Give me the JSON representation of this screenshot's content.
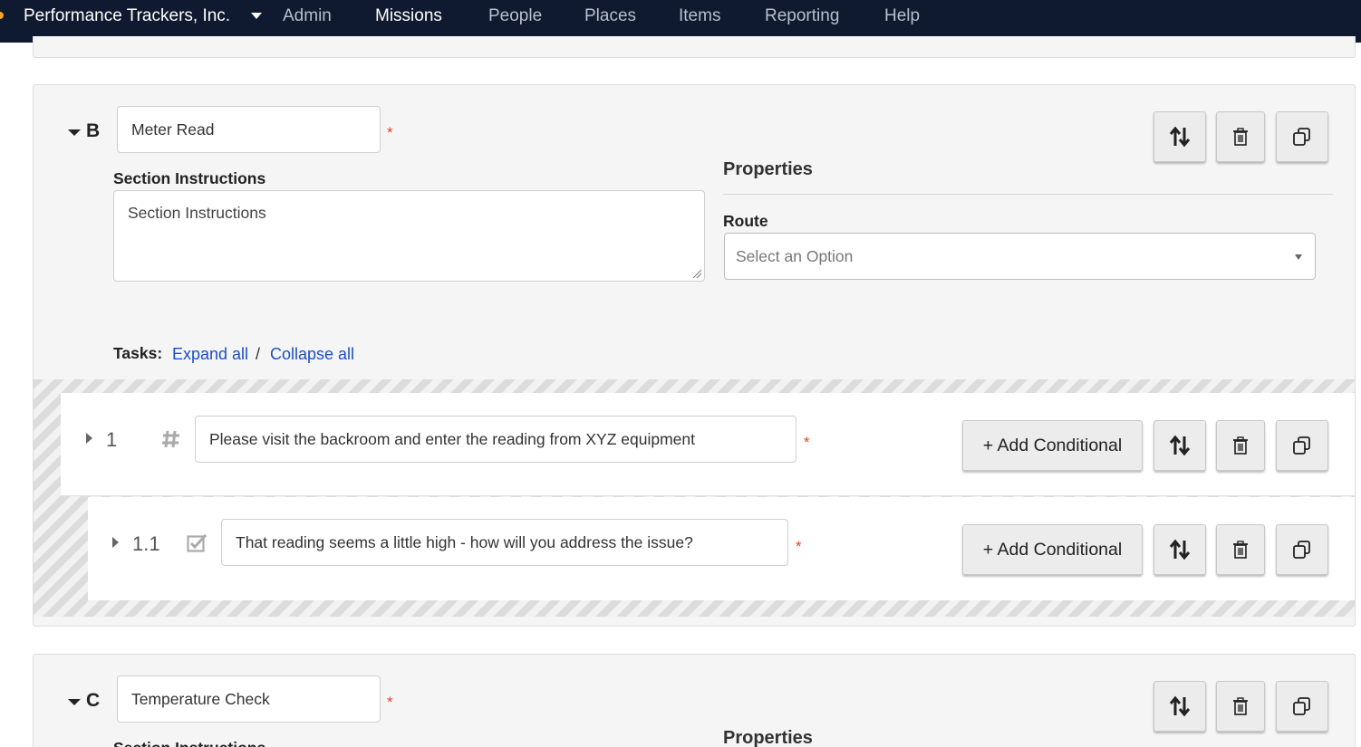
{
  "nav": {
    "brand": "Performance Trackers, Inc.",
    "items": [
      "Admin",
      "Missions",
      "People",
      "Places",
      "Items",
      "Reporting",
      "Help"
    ],
    "active": "Missions"
  },
  "section_b": {
    "letter": "B",
    "name": "Meter Read",
    "required_mark": "*",
    "instructions_label": "Section Instructions",
    "instructions_placeholder": "Section Instructions",
    "properties_title": "Properties",
    "route_label": "Route",
    "route_placeholder": "Select an Option",
    "tasks_label": "Tasks:",
    "expand_all": "Expand all",
    "slash": "/",
    "collapse_all": "Collapse all",
    "tasks": [
      {
        "number": "1",
        "type_icon": "hash-icon",
        "text": "Please visit the backroom and enter the reading from XYZ equipment",
        "add_conditional": "+ Add Conditional"
      },
      {
        "number": "1.1",
        "type_icon": "checkbox-icon",
        "text": "That reading seems a little high - how will you address the issue?",
        "add_conditional": "+ Add Conditional"
      }
    ]
  },
  "section_c": {
    "letter": "C",
    "name": "Temperature Check",
    "required_mark": "*",
    "instructions_label": "Section Instructions",
    "properties_title": "Properties"
  },
  "colors": {
    "nav_bg": "#0f1a30",
    "nav_active_underline": "#3aa0ea",
    "link": "#1a4fc5",
    "required": "#e0442b"
  }
}
